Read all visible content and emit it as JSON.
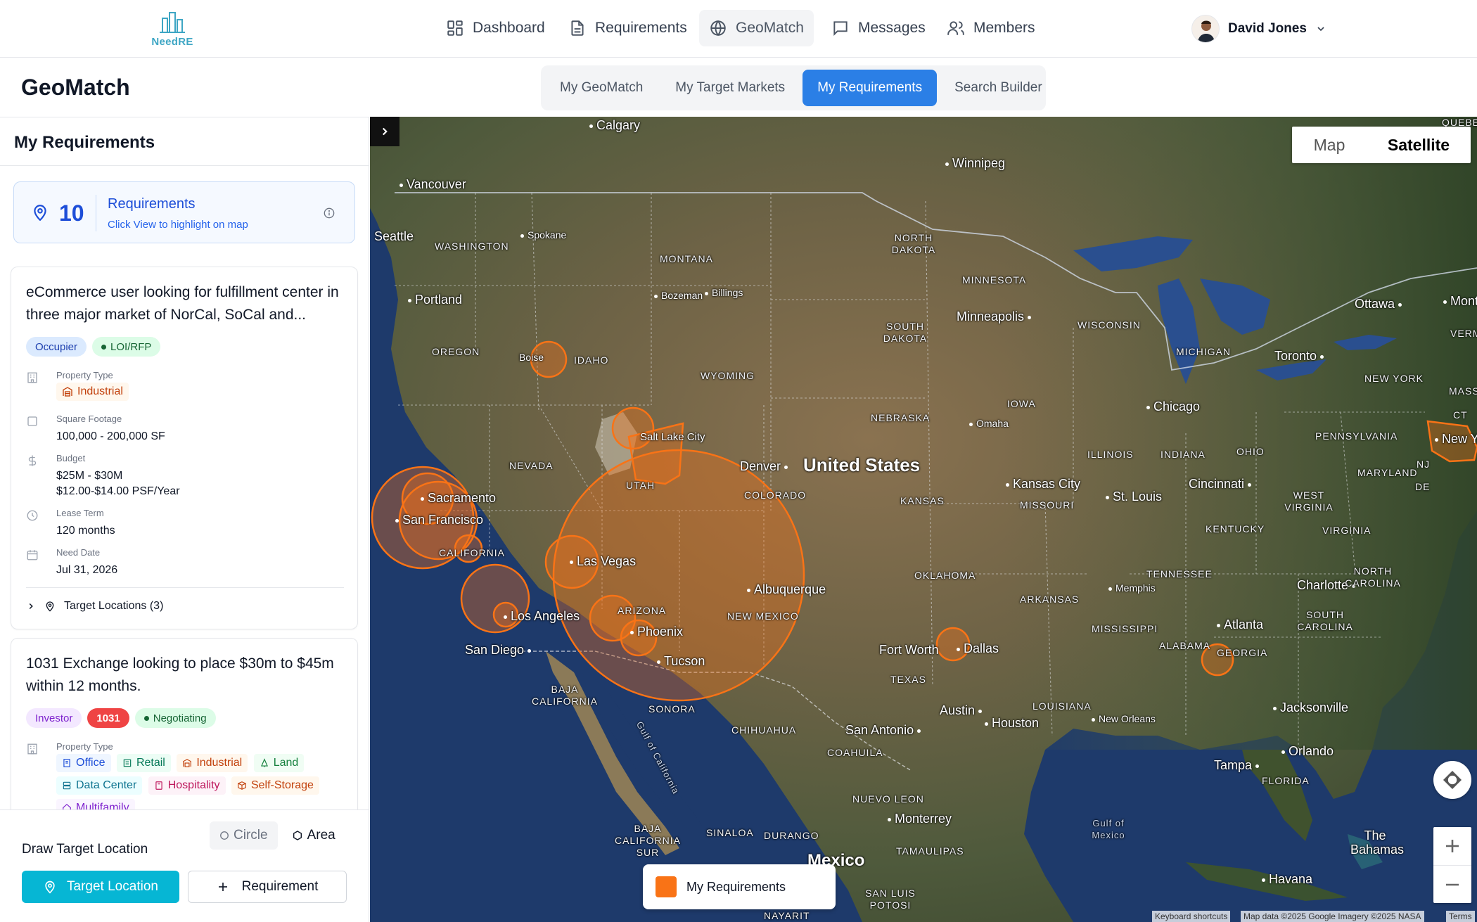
{
  "app": {
    "logo_text": "NeedRE"
  },
  "nav": {
    "items": [
      {
        "label": "Dashboard",
        "icon": "dashboard-icon"
      },
      {
        "label": "Requirements",
        "icon": "document-icon"
      },
      {
        "label": "GeoMatch",
        "icon": "globe-icon",
        "active": true
      },
      {
        "label": "Messages",
        "icon": "message-icon"
      },
      {
        "label": "Members",
        "icon": "users-icon"
      }
    ],
    "user_name": "David Jones"
  },
  "page": {
    "title": "GeoMatch",
    "tabs": [
      "My GeoMatch",
      "My Target Markets",
      "My Requirements",
      "Search Builder"
    ],
    "active_tab": "My Requirements"
  },
  "sidebar": {
    "title": "My Requirements",
    "summary": {
      "count": "10",
      "title": "Requirements",
      "subtitle": "Click View to highlight on map"
    },
    "cards": [
      {
        "title": "eCommerce user looking for fulfillment center in three major market of NorCal, SoCal and...",
        "badges": [
          "Occupier",
          "LOI/RFP"
        ],
        "property_type_label": "Property Type",
        "property_types": [
          "Industrial"
        ],
        "sqft_label": "Square Footage",
        "sqft": "100,000 - 200,000 SF",
        "budget_label": "Budget",
        "budget": "$25M - $30M",
        "budget_psf": "$12.00-$14.00 PSF/Year",
        "lease_label": "Lease Term",
        "lease": "120 months",
        "need_label": "Need Date",
        "need": "Jul 31, 2026",
        "locations": "Target Locations (3)"
      },
      {
        "title": "1031 Exchange looking to place $30m to $45m within 12 months.",
        "badges": [
          "Investor",
          "1031",
          "Negotiating"
        ],
        "property_type_label": "Property Type",
        "property_types": [
          "Office",
          "Retail",
          "Industrial",
          "Land",
          "Data Center",
          "Hospitality",
          "Self-Storage",
          "Multifamily"
        ]
      }
    ],
    "draw": {
      "label": "Draw Target Location",
      "circle": "Circle",
      "area": "Area",
      "target_button": "Target Location",
      "requirement_button": "Requirement"
    }
  },
  "map": {
    "type_map": "Map",
    "type_satellite": "Satellite",
    "active_type": "Satellite",
    "legend": "My Requirements",
    "overlay_color": "#f97316",
    "attribution": [
      "Keyboard shortcuts",
      "Map data ©2025 Google Imagery ©2025 NASA",
      "Terms"
    ],
    "country_label": "United States",
    "cities": [
      "Calgary",
      "Winnipeg",
      "Vancouver",
      "Seattle",
      "Spokane",
      "Portland",
      "Bozeman",
      "Billings",
      "Boise",
      "Salt Lake City",
      "Denver",
      "Sacramento",
      "San Francisco",
      "Las Vegas",
      "Los Angeles",
      "San Diego",
      "Phoenix",
      "Tucson",
      "Albuquerque",
      "Minneapolis",
      "Omaha",
      "Kansas City",
      "St. Louis",
      "Chicago",
      "Cincinnati",
      "Toronto",
      "Ottawa",
      "Montr",
      "New York",
      "Charlotte",
      "Atlanta",
      "Memphis",
      "Fort Worth",
      "Dallas",
      "Austin",
      "San Antonio",
      "Houston",
      "New Orleans",
      "Jacksonville",
      "Orlando",
      "Tampa",
      "Havana",
      "Monterrey",
      "Mexico",
      "The Bahamas"
    ],
    "states": [
      "WASHINGTON",
      "OREGON",
      "IDAHO",
      "MONTANA",
      "WYOMING",
      "NEVADA",
      "UTAH",
      "COLORADO",
      "CALIFORNIA",
      "ARIZONA",
      "NEW MEXICO",
      "NORTH DAKOTA",
      "SOUTH DAKOTA",
      "NEBRASKA",
      "KANSAS",
      "OKLAHOMA",
      "TEXAS",
      "MINNESOTA",
      "IOWA",
      "MISSOURI",
      "ARKANSAS",
      "LOUISIANA",
      "WISCONSIN",
      "ILLINOIS",
      "MICHIGAN",
      "INDIANA",
      "OHIO",
      "KENTUCKY",
      "TENNESSEE",
      "MISSISSIPPI",
      "ALABAMA",
      "GEORGIA",
      "FLORIDA",
      "SOUTH CAROLINA",
      "NORTH CAROLINA",
      "VIRGINIA",
      "WEST VIRGINIA",
      "PENNSYLVANIA",
      "NEW YORK",
      "MARYLAND",
      "NJ",
      "DE",
      "CT",
      "MASSA",
      "VERMO",
      "QUEBEC",
      "BAJA CALIFORNIA",
      "SONORA",
      "CHIHUAHUA",
      "NUEVO LEON",
      "COAHUILA",
      "SINALOA",
      "DURANGO",
      "TAMAULIPAS",
      "SAN LUIS POTOSI",
      "BAJA CALIFORNIA SUR",
      "NAYARIT",
      "Gulf of California",
      "Gulf of Mexico"
    ]
  }
}
